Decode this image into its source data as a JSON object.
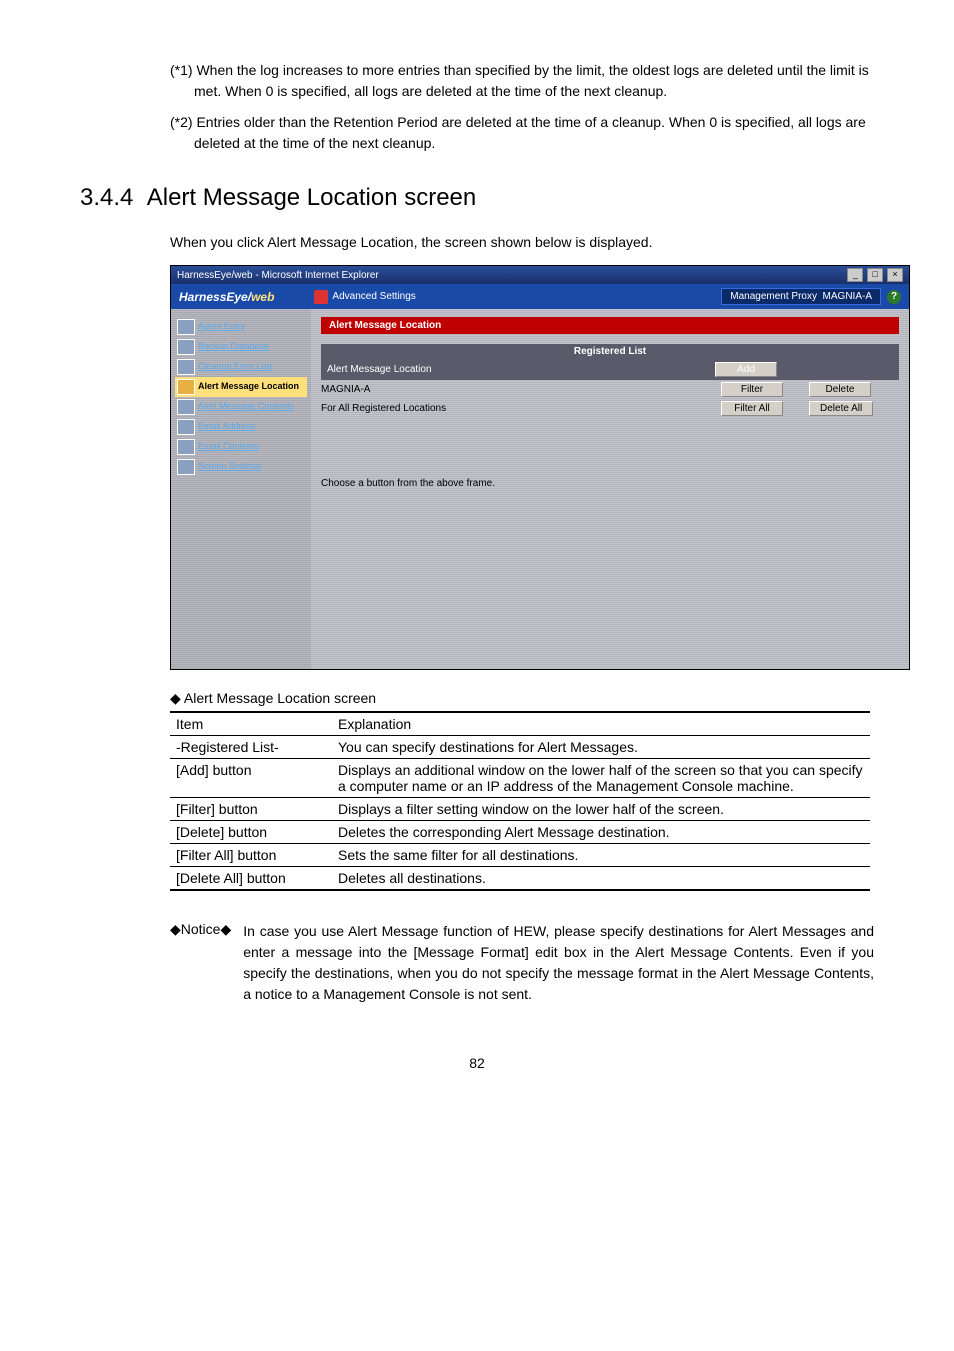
{
  "p_note1": "(*1) When the log increases to more entries than specified by the limit, the oldest logs are deleted until the limit is met. When 0 is specified, all logs are deleted at the time of the next cleanup.",
  "p_note2": "(*2) Entries older than the Retention Period are deleted at the time of a cleanup. When 0 is specified, all logs are deleted at the time of the next cleanup.",
  "heading_num": "3.4.4",
  "heading_text": "Alert Message Location screen",
  "intro": "When you click Alert Message Location, the screen shown below is displayed.",
  "screenshot": {
    "window_title": "HarnessEye/web - Microsoft Internet Explorer",
    "logo_main": "HarnessEye",
    "logo_slash": "/",
    "logo_web": "web",
    "adv_settings": "Advanced Settings",
    "mgmt_label": "Management Proxy",
    "mgmt_value": "MAGNIA-A",
    "help": "?",
    "side": [
      "Agent Entry",
      "Backup Database",
      "Cleanup Error Log",
      "Alert Message Location",
      "Alert Message Contents",
      "Email Address",
      "Email Contents",
      "Screen Settings"
    ],
    "main_title": "Alert Message Location",
    "reg_title": "Registered List",
    "row1_label": "Alert Message Location",
    "row1_btn": "Add",
    "row2_label": "MAGNIA-A",
    "row2_btn1": "Filter",
    "row2_btn2": "Delete",
    "row3_label": "For All Registered Locations",
    "row3_btn1": "Filter All",
    "row3_btn2": "Delete All",
    "hint": "Choose a button from the above frame.",
    "win_min": "_",
    "win_max": "□",
    "win_close": "×"
  },
  "table_caption": "◆ Alert Message Location screen",
  "th_item": "Item",
  "th_expl": "Explanation",
  "rows": [
    {
      "item": "-Registered List-",
      "expl": "You can specify destinations for Alert Messages."
    },
    {
      "item": "[Add] button",
      "expl": "Displays an additional window on the lower half of the screen so that you can specify a computer name or an IP address of the Management Console machine."
    },
    {
      "item": "[Filter] button",
      "expl": "Displays a filter setting window on the lower half of the screen."
    },
    {
      "item": "[Delete] button",
      "expl": "Deletes the corresponding Alert Message destination."
    },
    {
      "item": "[Filter All] button",
      "expl": "Sets the same filter for all destinations."
    },
    {
      "item": "[Delete All] button",
      "expl": "Deletes all destinations."
    }
  ],
  "notice_label": "◆Notice◆",
  "notice_text": "In case you use Alert Message function of HEW, please specify destinations for Alert Messages and enter a message into the [Message Format] edit box in the Alert Message Contents. Even if you specify the destinations, when you do not specify the message format in the Alert Message Contents, a notice to a Management Console is not sent.",
  "page_num": "82"
}
